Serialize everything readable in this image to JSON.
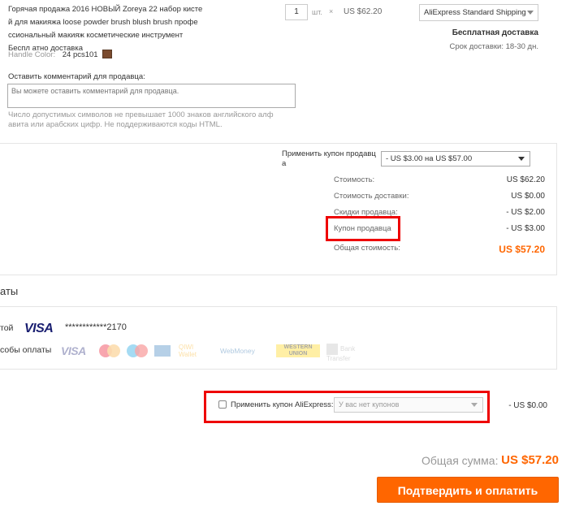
{
  "product": {
    "title": "Горячая продажа 2016 НОВЫЙ Zoreya 22 набор кисте й для макияжа loose powder brush blush brush профе ссиональный макияж косметические инструмент Беспл атно доставка",
    "handle_color_label": "Handle Color:",
    "handle_color_value": "24 pcs101",
    "quantity": "1",
    "unit": "шт.",
    "times": "×",
    "unit_price": "US $62.20"
  },
  "shipping": {
    "method": "AliExpress Standard Shipping",
    "free_label": "Бесплатная доставка",
    "time_label": "Срок доставки:",
    "time_value": "18-30 дн."
  },
  "comment": {
    "label": "Оставить комментарий для продавца:",
    "placeholder": "Вы можете оставить комментарий для продавца.",
    "hint": "Число допустимых символов не превышает 1000 знаков английского алф авита или арабских цифр. Не поддерживаются коды HTML."
  },
  "seller_coupon": {
    "label": "Применить купон продавц а",
    "selected": "- US $3.00 на US $57.00"
  },
  "summary": {
    "rows": [
      {
        "label": "Стоимость:",
        "value": "US $62.20"
      },
      {
        "label": "Стоимость доставки:",
        "value": "US $0.00"
      },
      {
        "label": "Скидки продавца:",
        "value": "- US $2.00"
      },
      {
        "label": "Купон продавца",
        "value": "- US $3.00"
      },
      {
        "label": "Общая стоимость:",
        "value": "US $57.20"
      }
    ]
  },
  "payment": {
    "heading": "аты",
    "card_label": "той",
    "card_brand": "VISA",
    "card_number": "************2170",
    "other_label": "собы оплаты",
    "methods": {
      "visa": "VISA",
      "qiwi": "QIWI Wallet",
      "webmoney": "WebMoney",
      "western_union": "WESTERN UNION",
      "bank_transfer": "Bank Transfer"
    }
  },
  "ali_coupon": {
    "label": "Применить купон AliExpress:",
    "placeholder": "У вас нет купонов",
    "discount": "- US $0.00"
  },
  "total": {
    "label": "Общая сумма:",
    "value": "US $57.20"
  },
  "confirm_button": "Подтвердить и оплатить",
  "colors": {
    "accent": "#ff6600",
    "highlight": "#e00000",
    "visa_blue": "#1a1f71"
  }
}
